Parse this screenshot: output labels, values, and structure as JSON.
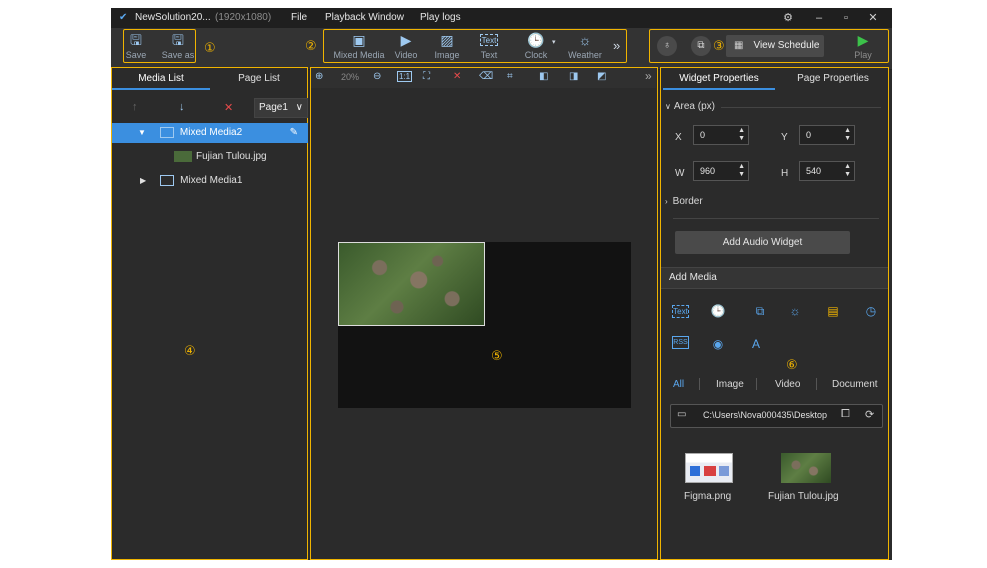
{
  "title_bar": {
    "app_name": "NewSolution20...",
    "resolution": "(1920x1080)",
    "menu": [
      "File",
      "Playback Window",
      "Play logs"
    ]
  },
  "toolbar": {
    "group1": [
      {
        "label": "Save",
        "icon": "save-icon"
      },
      {
        "label": "Save as",
        "icon": "save-as-icon"
      }
    ],
    "group2": [
      {
        "label": "Mixed Media",
        "icon": "mixed-media-icon"
      },
      {
        "label": "Video",
        "icon": "video-icon"
      },
      {
        "label": "Image",
        "icon": "image-icon"
      },
      {
        "label": "Text",
        "icon": "text-icon"
      },
      {
        "label": "Clock",
        "icon": "clock-icon"
      },
      {
        "label": "Weather",
        "icon": "weather-icon"
      }
    ],
    "view_schedule": "View Schedule",
    "play": "Play",
    "callouts": [
      "①",
      "②",
      "③",
      "④",
      "⑤",
      "⑥"
    ]
  },
  "left_panel": {
    "tabs": [
      "Media List",
      "Page List"
    ],
    "page_select": "Page1",
    "tree": [
      {
        "label": "Mixed Media2",
        "selected": true
      },
      {
        "label": "Fujian Tulou.jpg",
        "selected": false
      },
      {
        "label": "Mixed Media1",
        "selected": false
      }
    ]
  },
  "canvas": {
    "zoom": "20%"
  },
  "right_panel": {
    "tabs": [
      "Widget Properties",
      "Page Properties"
    ],
    "area_label": "Area (px)",
    "x_label": "X",
    "x_value": "0",
    "y_label": "Y",
    "y_value": "0",
    "w_label": "W",
    "w_value": "960",
    "h_label": "H",
    "h_value": "540",
    "border_label": "Border",
    "add_audio": "Add Audio Widget",
    "add_media": "Add Media",
    "filters": [
      "All",
      "Image",
      "Video",
      "Document"
    ],
    "path": "C:\\Users\\Nova000435\\Desktop",
    "files": [
      "Figma.png",
      "Fujian Tulou.jpg"
    ]
  },
  "colors": {
    "accent": "#3b8fe0",
    "callout": "#f0b400",
    "play": "#3cc24a"
  }
}
